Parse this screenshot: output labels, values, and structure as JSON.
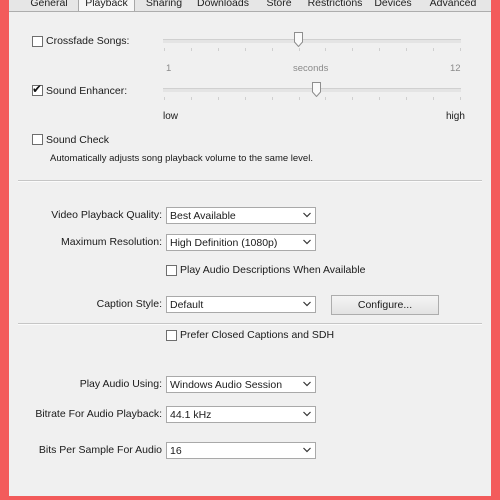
{
  "tabs": [
    {
      "label": "General",
      "selected": false
    },
    {
      "label": "Playback",
      "selected": true
    },
    {
      "label": "Sharing",
      "selected": false
    },
    {
      "label": "Downloads",
      "selected": false
    },
    {
      "label": "Store",
      "selected": false
    },
    {
      "label": "Restrictions",
      "selected": false
    },
    {
      "label": "Devices",
      "selected": false
    },
    {
      "label": "Advanced",
      "selected": false
    }
  ],
  "crossfade": {
    "label": "Crossfade Songs:",
    "checked": false,
    "min_label": "1",
    "unit_label": "seconds",
    "max_label": "12",
    "value": 6
  },
  "sound_enhancer": {
    "label": "Sound Enhancer:",
    "checked": true,
    "min_label": "low",
    "max_label": "high",
    "value": 0.5
  },
  "sound_check": {
    "label": "Sound Check",
    "checked": false,
    "description": "Automatically adjusts song playback volume to the same level."
  },
  "video": {
    "quality_label": "Video Playback Quality:",
    "quality_value": "Best Available",
    "resolution_label": "Maximum Resolution:",
    "resolution_value": "High Definition (1080p)",
    "audio_desc_label": "Play Audio Descriptions When Available",
    "audio_desc_checked": false,
    "caption_label": "Caption Style:",
    "caption_value": "Default",
    "configure_label": "Configure...",
    "cc_label": "Prefer Closed Captions and SDH",
    "cc_checked": false
  },
  "audio": {
    "play_using_label": "Play Audio Using:",
    "play_using_value": "Windows Audio Session",
    "bitrate_label": "Bitrate For Audio Playback:",
    "bitrate_value": "44.1 kHz",
    "bits_label": "Bits Per Sample For Audio",
    "bits_value": "16"
  },
  "colors": {
    "frame": "#f35b5b",
    "background": "#f0f0f0"
  }
}
